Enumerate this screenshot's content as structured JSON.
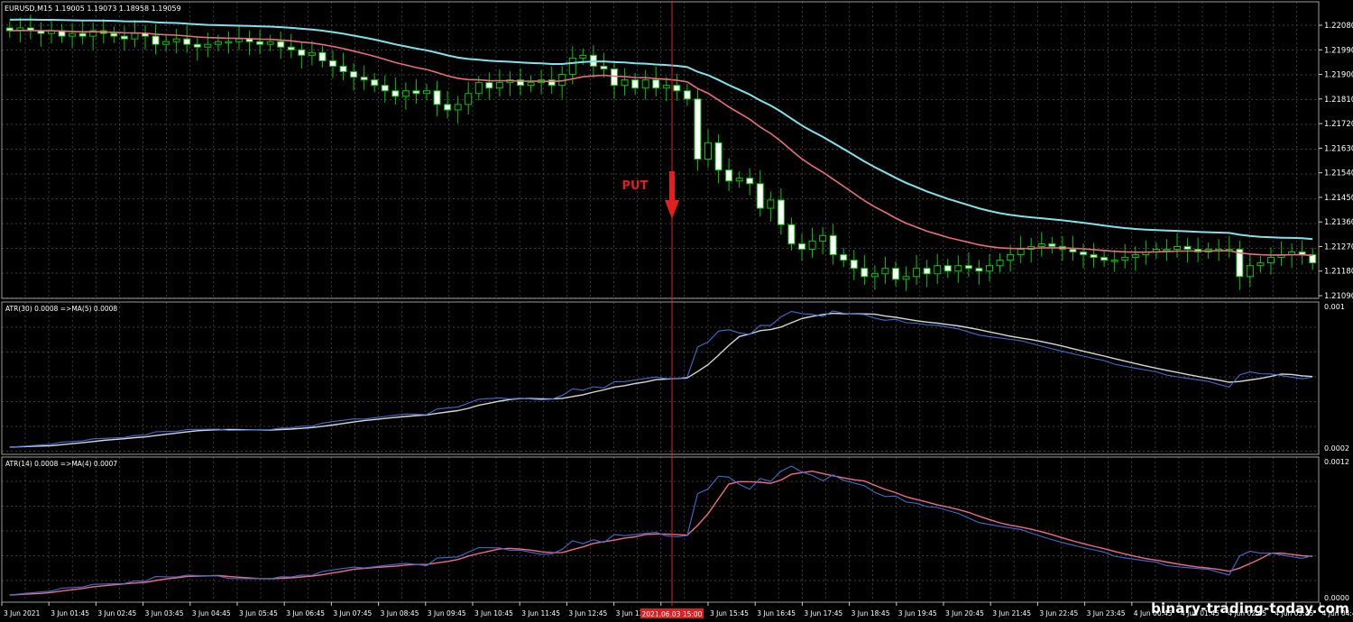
{
  "symbol_info": "EURUSD,M15  1.19005 1.19073 1.18958 1.19059",
  "panes": {
    "main": {
      "price_axis": [
        "1.22080",
        "1.21990",
        "1.21900",
        "1.21810",
        "1.21720",
        "1.21630",
        "1.21540",
        "1.21450",
        "1.21360",
        "1.21270",
        "1.21180",
        "1.21090"
      ]
    },
    "atr30": {
      "label": "ATR(30) 0.0008  =>MA(5) 0.0008",
      "axis_top": "0.001",
      "axis_bottom": "0.0002"
    },
    "atr14": {
      "label": "ATR(14) 0.0008  =>MA(4) 0.0007",
      "axis_top": "0.0012",
      "axis_bottom": "0.0000"
    }
  },
  "signal": {
    "text": "PUT",
    "time_label": "2021.06.03 15:00"
  },
  "time_axis": [
    "3 Jun 2021",
    "3 Jun 01:45",
    "3 Jun 02:45",
    "3 Jun 03:45",
    "3 Jun 04:45",
    "3 Jun 05:45",
    "3 Jun 06:45",
    "3 Jun 07:45",
    "3 Jun 08:45",
    "3 Jun 09:45",
    "3 Jun 10:45",
    "3 Jun 11:45",
    "3 Jun 12:45",
    "3 Jun 13:45",
    "",
    "3 Jun 15:45",
    "3 Jun 16:45",
    "3 Jun 17:45",
    "3 Jun 18:45",
    "3 Jun 19:45",
    "3 Jun 20:45",
    "3 Jun 21:45",
    "3 Jun 22:45",
    "3 Jun 23:45",
    "4 Jun 00:45",
    "4 Jun 01:45",
    "4 Jun 02:45",
    "4 Jun 03:45",
    "4 Jun 04:45"
  ],
  "watermark": "binary-trading-today.com",
  "colors": {
    "background": "#000000",
    "grid": "#8a8a8a",
    "bull_candle": "#000000",
    "bear_candle": "#ffffff",
    "wick_outline": "#00c800",
    "fast_ma": "#ee6b7a",
    "slow_ma": "#7fe3ec",
    "atr_blue": "#3b6fd1",
    "atr_white": "#d6d6d6",
    "atr_pink": "#f06a86",
    "signal": "#e02020"
  },
  "chart_data": {
    "type": "candlestick",
    "closes": [
      1.2206,
      1.2207,
      1.2206,
      1.2205,
      1.2206,
      1.2204,
      1.2205,
      1.2204,
      1.2206,
      1.2205,
      1.2204,
      1.2203,
      1.2205,
      1.2204,
      1.2201,
      1.2202,
      1.2203,
      1.2201,
      1.22,
      1.2201,
      1.2202,
      1.2202,
      1.2203,
      1.2202,
      1.2201,
      1.2202,
      1.22,
      1.2199,
      1.2197,
      1.2198,
      1.2195,
      1.2193,
      1.2191,
      1.2189,
      1.2188,
      1.2186,
      1.2184,
      1.2182,
      1.2184,
      1.2183,
      1.2184,
      1.2179,
      1.2177,
      1.2179,
      1.2183,
      1.2187,
      1.2185,
      1.2187,
      1.2188,
      1.2186,
      1.2187,
      1.2188,
      1.2186,
      1.219,
      1.2196,
      1.2197,
      1.2193,
      1.2192,
      1.2186,
      1.2188,
      1.2185,
      1.2188,
      1.2185,
      1.2186,
      1.2184,
      1.2181,
      1.2159,
      1.2165,
      1.2155,
      1.2151,
      1.2152,
      1.215,
      1.2141,
      1.2144,
      1.2135,
      1.2128,
      1.2126,
      1.2129,
      1.2131,
      1.2124,
      1.2122,
      1.2119,
      1.2116,
      1.2117,
      1.2119,
      1.2115,
      1.2116,
      1.2119,
      1.2117,
      1.212,
      1.2118,
      1.212,
      1.2119,
      1.2118,
      1.212,
      1.2122,
      1.2124,
      1.2126,
      1.2127,
      1.2128,
      1.2127,
      1.2126,
      1.2125,
      1.2124,
      1.2123,
      1.2122,
      1.2122,
      1.2123,
      1.2124,
      1.2125,
      1.2126,
      1.2126,
      1.2127,
      1.2126,
      1.2125,
      1.2126,
      1.2126,
      1.2126,
      1.2116,
      1.212,
      1.2121,
      1.2123,
      1.2124,
      1.2125,
      1.2124,
      1.2121
    ]
  }
}
